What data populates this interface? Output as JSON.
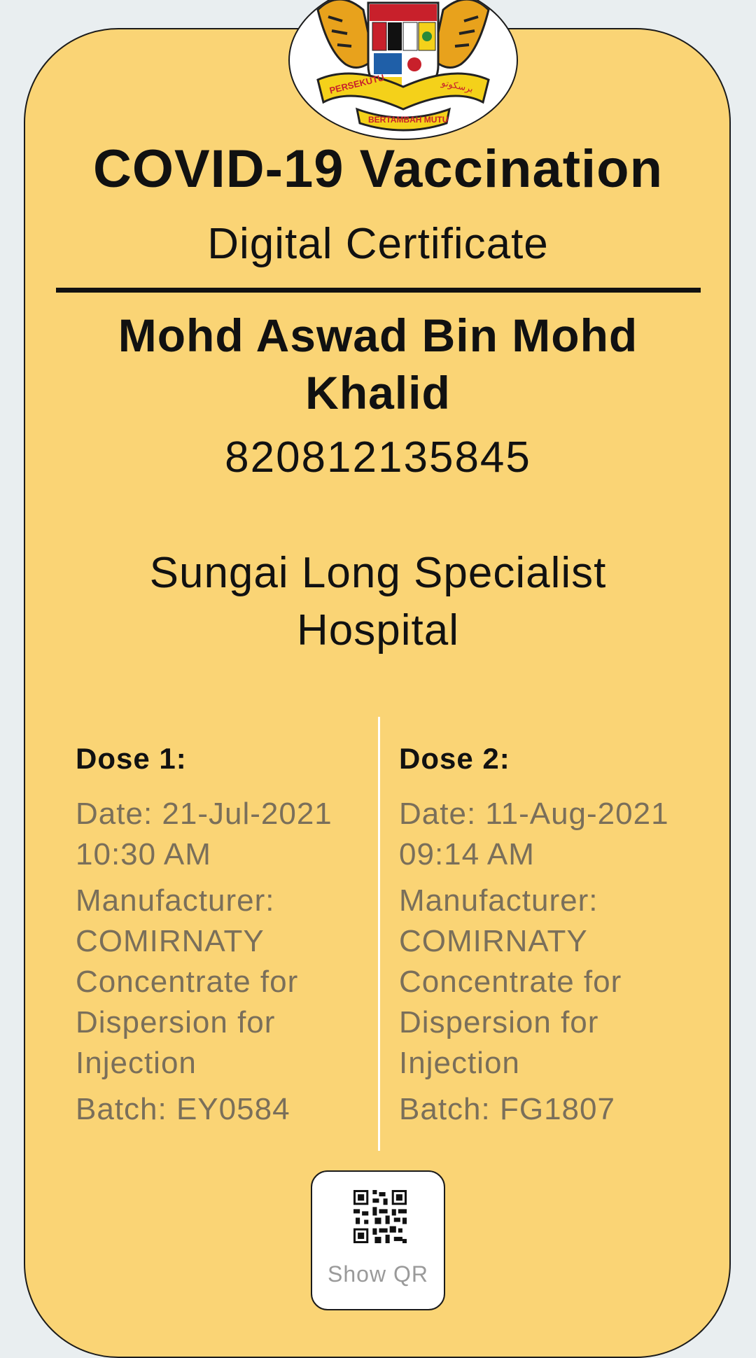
{
  "certificate": {
    "title": "COVID-19 Vaccination",
    "subtitle": "Digital Certificate",
    "name": "Mohd Aswad Bin Mohd Khalid",
    "id_number": "820812135845",
    "facility": "Sungai Long Specialist Hospital"
  },
  "crest": {
    "text_top": "PERSEKUTU",
    "text_motto": "BERTAMBAH MUTU",
    "text_jawi": "برسكوتو"
  },
  "doses": [
    {
      "title": "Dose 1:",
      "date": "Date: 21-Jul-2021 10:30 AM",
      "manufacturer": "Manufacturer: COMIRNATY Concentrate for Dispersion for Injection",
      "batch": "Batch: EY0584"
    },
    {
      "title": "Dose 2:",
      "date": "Date: 11-Aug-2021 09:14 AM",
      "manufacturer": "Manufacturer: COMIRNATY Concentrate for Dispersion for Injection",
      "batch": "Batch: FG1807"
    }
  ],
  "qr_button": {
    "label": "Show QR",
    "icon": "qr-code-icon"
  },
  "colors": {
    "card_background": "#fad475",
    "page_background": "#e9eef0",
    "text_dark": "#111111",
    "text_muted": "#7a6f5a"
  }
}
